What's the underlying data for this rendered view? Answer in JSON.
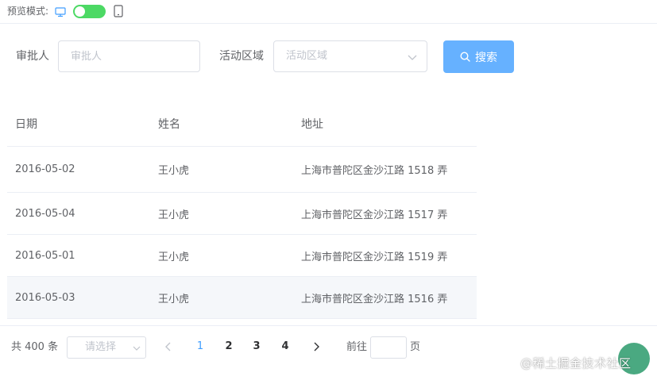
{
  "preview": {
    "label": "预览模式:",
    "toggle_on": true
  },
  "form": {
    "approver_label": "审批人",
    "approver_placeholder": "审批人",
    "region_label": "活动区域",
    "region_placeholder": "活动区域",
    "search_button": "搜索"
  },
  "table": {
    "headers": [
      "日期",
      "姓名",
      "地址"
    ],
    "rows": [
      {
        "date": "2016-05-02",
        "name": "王小虎",
        "address": "上海市普陀区金沙江路 1518 弄"
      },
      {
        "date": "2016-05-04",
        "name": "王小虎",
        "address": "上海市普陀区金沙江路 1517 弄"
      },
      {
        "date": "2016-05-01",
        "name": "王小虎",
        "address": "上海市普陀区金沙江路 1519 弄"
      },
      {
        "date": "2016-05-03",
        "name": "王小虎",
        "address": "上海市普陀区金沙江路 1516 弄"
      }
    ]
  },
  "pagination": {
    "total": "共 400 条",
    "page_size_placeholder": "请选择",
    "pages": [
      "1",
      "2",
      "3",
      "4"
    ],
    "current_page": "1",
    "goto_label": "前往",
    "goto_value": "",
    "page_suffix": "页"
  },
  "watermark": "@稀土掘金技术社区",
  "colors": {
    "primary": "#409eff",
    "button": "#66b1ff",
    "toggle": "#4cd964",
    "border": "#dcdfe6",
    "hover_row": "#f5f7fa",
    "fab": "#3ba276"
  },
  "icons": {
    "preview_desktop": "desktop-icon",
    "preview_tablet": "tablet-icon",
    "select_arrow": "chevron-down-icon",
    "search": "search-icon",
    "prev_page": "chevron-left-icon",
    "next_page": "chevron-right-icon"
  }
}
